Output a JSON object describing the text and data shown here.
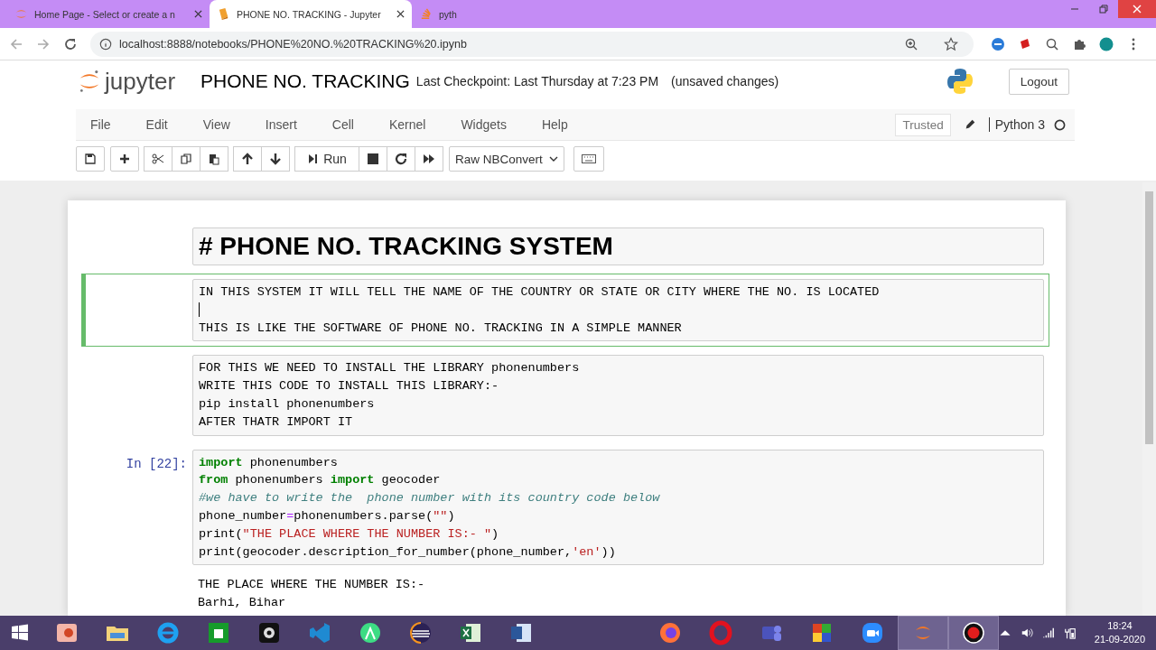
{
  "browser": {
    "tabs": [
      {
        "title": "Home Page - Select or create a n",
        "selected": false,
        "kind": "jupyter"
      },
      {
        "title": "PHONE NO. TRACKING - Jupyter",
        "selected": true,
        "kind": "notebook"
      },
      {
        "title": "pyth",
        "selected": false,
        "kind": "stack"
      }
    ],
    "address": "localhost:8888/notebooks/PHONE%20NO.%20TRACKING%20.ipynb"
  },
  "header": {
    "logo": "jupyter",
    "title": "PHONE NO. TRACKING",
    "checkpoint": "Last Checkpoint: Last Thursday at 7:23 PM",
    "status": "(unsaved changes)",
    "logout": "Logout"
  },
  "menu": [
    "File",
    "Edit",
    "View",
    "Insert",
    "Cell",
    "Kernel",
    "Widgets",
    "Help"
  ],
  "kernel": {
    "trusted": "Trusted",
    "name": "Python 3",
    "busy": false
  },
  "toolbar": {
    "run": "Run",
    "cell_type": "Raw NBConvert"
  },
  "cells": [
    {
      "kind": "heading",
      "selected": false,
      "text": "# PHONE NO. TRACKING SYSTEM"
    },
    {
      "kind": "text",
      "selected": true,
      "editing": true,
      "paragraphs": [
        "IN THIS SYSTEM IT WILL TELL THE NAME OF THE COUNTRY OR STATE OR CITY WHERE THE NO. IS LOCATED",
        "THIS IS LIKE THE SOFTWARE OF PHONE NO. TRACKING IN A SIMPLE MANNER"
      ]
    },
    {
      "kind": "raw",
      "selected": false,
      "lines": [
        "FOR THIS WE NEED TO INSTALL THE LIBRARY phonenumbers",
        "WRITE THIS CODE TO INSTALL THIS LIBRARY:-",
        "pip install phonenumbers",
        "AFTER THATR IMPORT IT"
      ]
    },
    {
      "kind": "code",
      "selected": false,
      "prompt": "In [22]:",
      "code": [
        [
          {
            "text": "import",
            "kind": "keyword"
          },
          {
            "text": " phonenumbers",
            "kind": "plain"
          }
        ],
        [
          {
            "text": "from",
            "kind": "keyword"
          },
          {
            "text": " phonenumbers ",
            "kind": "plain"
          },
          {
            "text": "import",
            "kind": "keyword"
          },
          {
            "text": " geocoder",
            "kind": "plain"
          }
        ],
        [
          {
            "text": "#we have to write the  phone number with its country code below",
            "kind": "comment"
          }
        ],
        [
          {
            "text": "phone_number",
            "kind": "plain"
          },
          {
            "text": "=",
            "kind": "operator"
          },
          {
            "text": "phonenumbers.parse(",
            "kind": "plain"
          },
          {
            "text": "\"\"",
            "kind": "string"
          },
          {
            "text": ")",
            "kind": "plain"
          }
        ],
        [
          {
            "text": "print(",
            "kind": "plain"
          },
          {
            "text": "\"THE PLACE WHERE THE NUMBER IS:- \"",
            "kind": "string"
          },
          {
            "text": ")",
            "kind": "plain"
          }
        ],
        [
          {
            "text": "print(geocoder.description_for_number(phone_number,",
            "kind": "plain"
          },
          {
            "text": "'en'",
            "kind": "string"
          },
          {
            "text": "))",
            "kind": "plain"
          }
        ]
      ],
      "output": [
        "THE PLACE WHERE THE NUMBER IS:-",
        "Barhi, Bihar"
      ]
    }
  ],
  "taskbar": {
    "apps": [
      {
        "kind": "powerpoint",
        "active": false
      },
      {
        "kind": "folder",
        "active": false
      },
      {
        "kind": "ie",
        "active": false
      },
      {
        "kind": "store",
        "active": false
      },
      {
        "kind": "camera",
        "active": false
      },
      {
        "kind": "vscode",
        "active": false
      },
      {
        "kind": "android",
        "active": false
      },
      {
        "kind": "eclipse",
        "active": false
      },
      {
        "kind": "excel",
        "active": false
      },
      {
        "kind": "word",
        "active": false
      },
      {
        "kind": "gap"
      },
      {
        "kind": "firefox",
        "active": false
      },
      {
        "kind": "opera",
        "active": false
      },
      {
        "kind": "teams",
        "active": false
      },
      {
        "kind": "tiles",
        "active": false
      },
      {
        "kind": "zoom",
        "active": false
      },
      {
        "kind": "anaconda",
        "active": true
      },
      {
        "kind": "record",
        "active": true
      }
    ],
    "time": "18:24",
    "date": "21-09-2020"
  }
}
